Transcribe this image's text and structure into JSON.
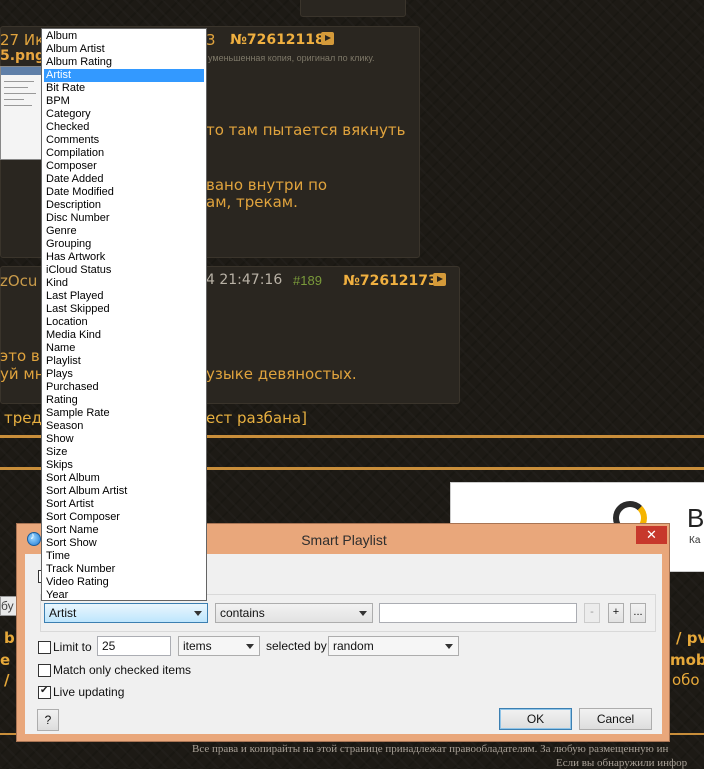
{
  "background": {
    "post1": {
      "date_fragment": "27 Ик",
      "file_fragment": "5.png",
      "time_fragment": "3",
      "post_number": "№72612118",
      "thumb_caption": "уменьшенная копия, оригинал по клику.",
      "line1": "то там пытается вякнуть",
      "line2": "вано внутри по",
      "line3": "ам, трекам."
    },
    "post2": {
      "name_fragment": "zOcu",
      "time_fragment": "4 21:47:16",
      "reply_count": "#189",
      "post_number": "№72612173",
      "line1": "это вн",
      "line2": "уй мн",
      "line3": "узыке девяностых."
    },
    "thread_links": {
      "left": "тред",
      "right": "ест разбана]"
    },
    "ad": {
      "letter": "B",
      "sub": "Ка"
    },
    "nav": {
      "search_fragment": "бу",
      "bi": "bi",
      "slash1": "/",
      "pv": "/ pv",
      "e": "e",
      "mobi": "mobi",
      "slash2": "/ r",
      "obo": "обо"
    },
    "footer1": "Все права и копирайты на этой странице принадлежат правообладателям. За любую размещенную ин",
    "footer2": "Если вы обнаружили инфор"
  },
  "dialog": {
    "title": "Smart Playlist",
    "close_label": "✕",
    "rule": {
      "field": "Artist",
      "operator": "contains",
      "value": "",
      "remove_label": "-",
      "add_label": "+",
      "more_label": "..."
    },
    "limit": {
      "label": "Limit to",
      "checked": false,
      "value": "25",
      "unit": "items",
      "selected_by_label": "selected by",
      "selected_by": "random"
    },
    "match_checked": {
      "label": "Match only checked items",
      "checked": false
    },
    "live_updating": {
      "label": "Live updating",
      "checked": true
    },
    "help_label": "?",
    "ok_label": "OK",
    "cancel_label": "Cancel"
  },
  "dropdown": {
    "selected": "Artist",
    "items": [
      "Album",
      "Album Artist",
      "Album Rating",
      "Artist",
      "Bit Rate",
      "BPM",
      "Category",
      "Checked",
      "Comments",
      "Compilation",
      "Composer",
      "Date Added",
      "Date Modified",
      "Description",
      "Disc Number",
      "Genre",
      "Grouping",
      "Has Artwork",
      "iCloud Status",
      "Kind",
      "Last Played",
      "Last Skipped",
      "Location",
      "Media Kind",
      "Name",
      "Playlist",
      "Plays",
      "Purchased",
      "Rating",
      "Sample Rate",
      "Season",
      "Show",
      "Size",
      "Skips",
      "Sort Album",
      "Sort Album Artist",
      "Sort Artist",
      "Sort Composer",
      "Sort Name",
      "Sort Show",
      "Time",
      "Track Number",
      "Video Rating",
      "Year"
    ]
  }
}
